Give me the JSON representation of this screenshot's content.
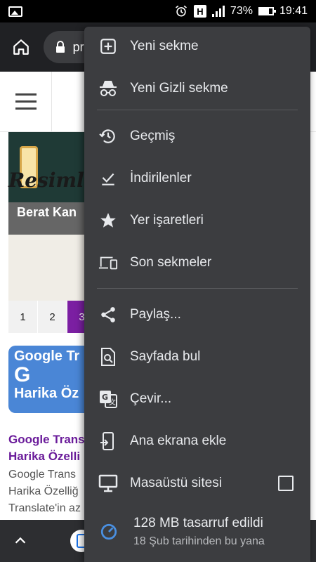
{
  "status_bar": {
    "battery": "73%",
    "battery_level": 0.73,
    "time": "19:41",
    "h_badge": "H"
  },
  "toolbar": {
    "url_text": "pr"
  },
  "page": {
    "banner_title": "Resimli",
    "banner_caption": "Berat Kan",
    "pages": [
      "1",
      "2",
      "3"
    ],
    "thumb_line1": "Google Tr",
    "thumb_line2": "G",
    "thumb_line3": "Harika Öz",
    "article_title_1": "Google Trans",
    "article_title_2": "Harika Özelli",
    "article_body_1": "Google Trans",
    "article_body_2": "Harika Özelliğ",
    "article_body_3": "Translate'in az"
  },
  "menu": {
    "items": [
      {
        "label": "Yeni sekme",
        "icon": "new-tab-icon"
      },
      {
        "label": "Yeni Gizli sekme",
        "icon": "incognito-icon"
      },
      {
        "label": "Geçmiş",
        "icon": "history-icon"
      },
      {
        "label": "İndirilenler",
        "icon": "downloads-icon"
      },
      {
        "label": "Yer işaretleri",
        "icon": "star-icon"
      },
      {
        "label": "Son sekmeler",
        "icon": "devices-icon"
      },
      {
        "label": "Paylaş...",
        "icon": "share-icon"
      },
      {
        "label": "Sayfada bul",
        "icon": "find-in-page-icon"
      },
      {
        "label": "Çevir...",
        "icon": "translate-icon"
      },
      {
        "label": "Ana ekrana ekle",
        "icon": "add-to-home-icon"
      },
      {
        "label": "Masaüstü sitesi",
        "icon": "desktop-icon"
      }
    ],
    "savings_title": "128 MB tasarruf edildi",
    "savings_subtitle": "18 Şub tarihinden bu yana",
    "desktop_checked": false
  }
}
